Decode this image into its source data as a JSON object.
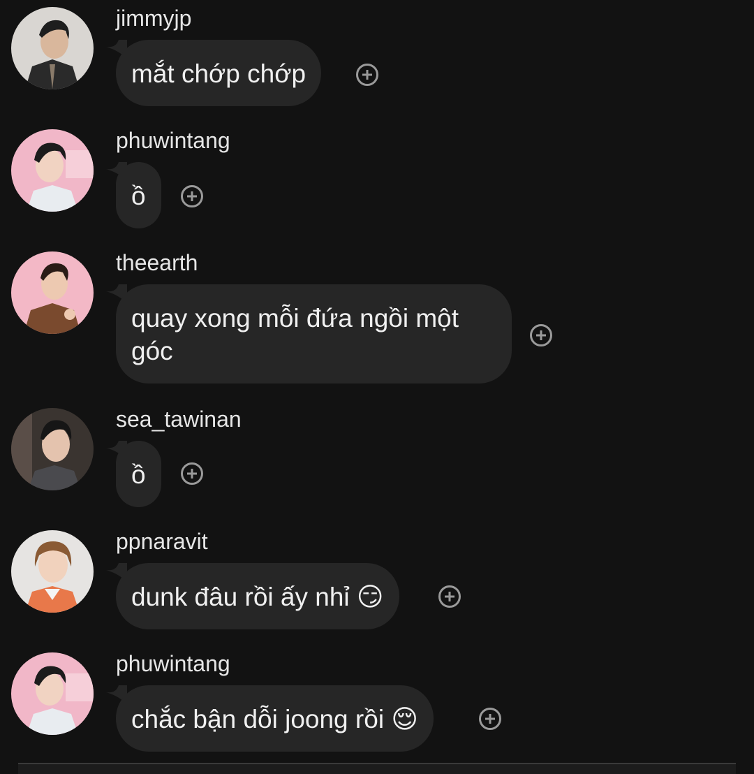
{
  "messages": [
    {
      "username": "jimmyjp",
      "text": "mắt chớp chớp"
    },
    {
      "username": "phuwintang",
      "text": "ồ"
    },
    {
      "username": "theearth",
      "text": "quay xong mỗi đứa ngồi một\ngóc"
    },
    {
      "username": "sea_tawinan",
      "text": "ồ"
    },
    {
      "username": "ppnaravit",
      "text": "dunk đâu rồi ấy nhỉ 😏"
    },
    {
      "username": "phuwintang",
      "text": "chắc bận dỗi joong rồi 😌"
    }
  ],
  "colors": {
    "background": "#121212",
    "bubble": "#262626",
    "text": "#f0f0f0",
    "icon": "#9a9a9a"
  },
  "icons": {
    "react": "add-reaction-icon"
  }
}
